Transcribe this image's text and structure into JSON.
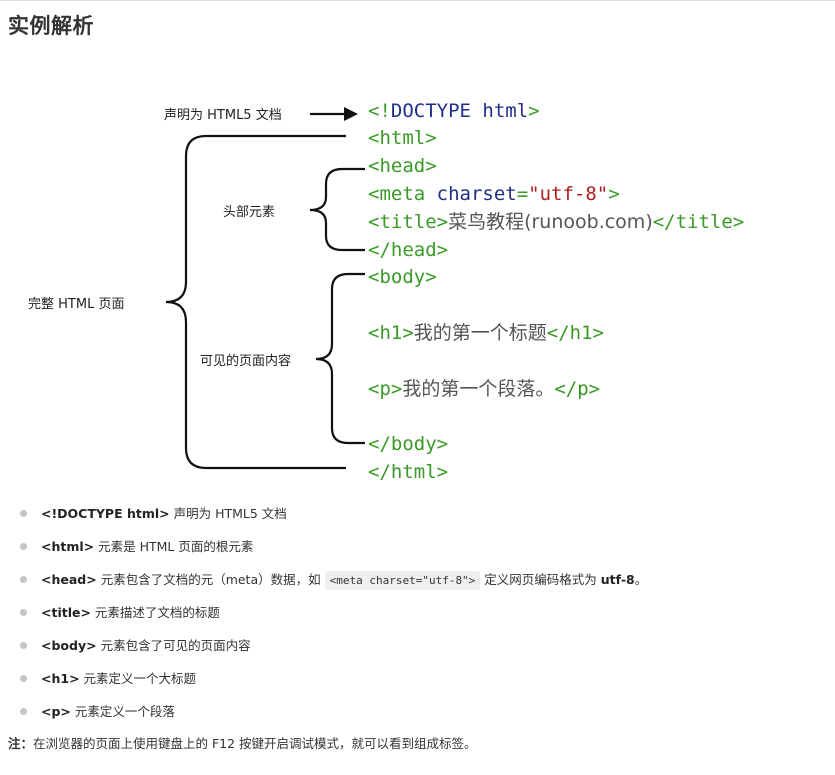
{
  "page": {
    "heading": "实例解析"
  },
  "diagram": {
    "labels": {
      "doctype": "声明为 HTML5 文档",
      "head": "头部元素",
      "page": "完整 HTML 页面",
      "body": "可见的页面内容"
    },
    "code": {
      "doctype_open": "<!",
      "doctype_kw": "DOCTYPE html",
      "doctype_close": ">",
      "html_open": "<html>",
      "head_open": "<head>",
      "meta_tag": "<meta ",
      "meta_attr": "charset",
      "meta_eq": "=",
      "meta_val": "\"utf-8\"",
      "meta_close": ">",
      "title_open": "<title>",
      "title_text": "菜鸟教程(runoob.com)",
      "title_close": "</title>",
      "head_close": "</head>",
      "body_open": "<body>",
      "h1_open": "<h1>",
      "h1_text": "我的第一个标题",
      "h1_close": "</h1>",
      "p_open": "<p>",
      "p_text": "我的第一个段落。",
      "p_close": "</p>",
      "body_close": "</body>",
      "html_close": "</html>"
    }
  },
  "notes": [
    {
      "tag": "<!DOCTYPE html>",
      "text": " 声明为 HTML5 文档"
    },
    {
      "tag": "<html>",
      "text": " 元素是 HTML 页面的根元素"
    },
    {
      "tag": "<head>",
      "text": " 元素包含了文档的元（meta）数据，如 ",
      "code": "<meta charset=\"utf-8\">",
      "text2": " 定义网页编码格式为 ",
      "bold2": "utf-8",
      "text3": "。"
    },
    {
      "tag": "<title>",
      "text": " 元素描述了文档的标题"
    },
    {
      "tag": "<body>",
      "text": " 元素包含了可见的页面内容"
    },
    {
      "tag": "<h1>",
      "text": " 元素定义一个大标题"
    },
    {
      "tag": "<p>",
      "text": " 元素定义一个段落"
    }
  ],
  "footnote": {
    "label": "注：",
    "text": "在浏览器的页面上使用键盘上的 F12 按键开启调试模式，就可以看到组成标签。"
  },
  "colors": {
    "tag": "#3a9a26",
    "keyword": "#1f2f88",
    "string": "#b01c1c",
    "bullet": "#c4c4c4",
    "inline_code_bg": "#efefef"
  }
}
